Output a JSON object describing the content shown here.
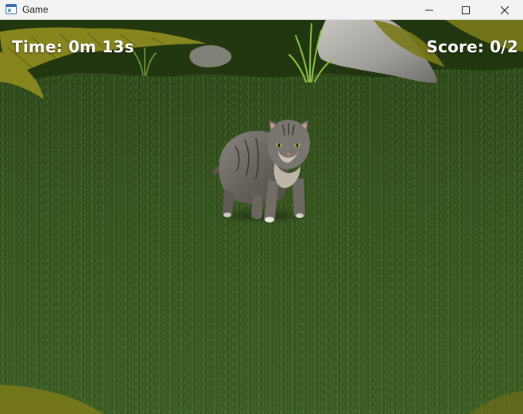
{
  "window": {
    "title": "Game",
    "icon": "app-window-icon"
  },
  "controls": {
    "minimize": "minimize-icon",
    "maximize": "maximize-icon",
    "close": "close-icon"
  },
  "hud": {
    "time": "Time: 0m 13s",
    "score": "Score: 0/2"
  },
  "colors": {
    "grass_dark": "#1f3512",
    "grass_mid": "#3a5a24",
    "grass_light": "#5f8a3a",
    "rock": "#a9a7a3",
    "palm": "#8a8a1e",
    "cat_fur": "#6e6a66"
  }
}
